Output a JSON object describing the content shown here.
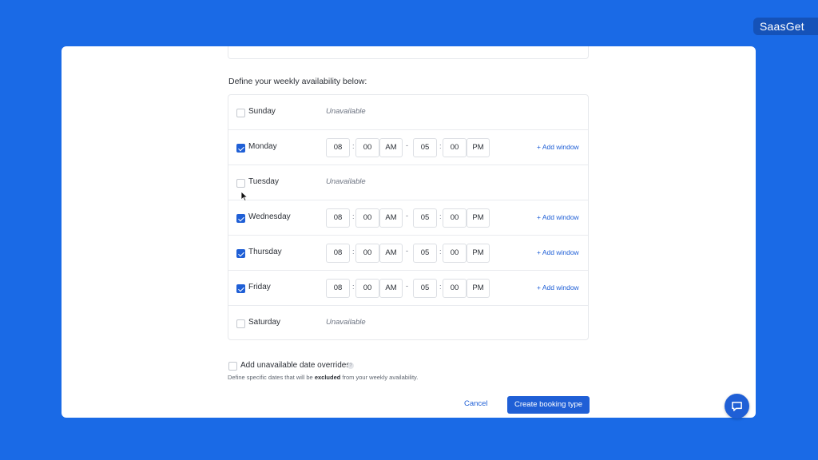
{
  "brand": {
    "name": "SaasGet"
  },
  "availability": {
    "title": "Define your weekly availability below:",
    "unavailable_text": "Unavailable",
    "add_window_label": "+ Add window",
    "days": [
      {
        "name": "Sunday",
        "checked": false,
        "unavailable": "Unavailable"
      },
      {
        "name": "Monday",
        "checked": true,
        "start_hour": "08",
        "start_min": "00",
        "start_ampm": "AM",
        "end_hour": "05",
        "end_min": "00",
        "end_ampm": "PM",
        "add_window": "+ Add window"
      },
      {
        "name": "Tuesday",
        "checked": false,
        "unavailable": "Unavailable"
      },
      {
        "name": "Wednesday",
        "checked": true,
        "start_hour": "08",
        "start_min": "00",
        "start_ampm": "AM",
        "end_hour": "05",
        "end_min": "00",
        "end_ampm": "PM",
        "add_window": "+ Add window"
      },
      {
        "name": "Thursday",
        "checked": true,
        "start_hour": "08",
        "start_min": "00",
        "start_ampm": "AM",
        "end_hour": "05",
        "end_min": "00",
        "end_ampm": "PM",
        "add_window": "+ Add window"
      },
      {
        "name": "Friday",
        "checked": true,
        "start_hour": "08",
        "start_min": "00",
        "start_ampm": "AM",
        "end_hour": "05",
        "end_min": "00",
        "end_ampm": "PM",
        "add_window": "+ Add window"
      },
      {
        "name": "Saturday",
        "checked": false,
        "unavailable": "Unavailable"
      }
    ]
  },
  "overrides": {
    "label": "Add unavailable date overrides",
    "checked": false,
    "desc_prefix": "Define specific dates that will be ",
    "desc_bold": "excluded",
    "desc_suffix": " from your weekly availability."
  },
  "footer": {
    "cancel_label": "Cancel",
    "submit_label": "Create booking type"
  },
  "colors": {
    "background": "#1a6ae6",
    "accent": "#1f5fd6"
  },
  "icons": {
    "chat": "chat-bubble-icon",
    "info": "info-icon",
    "cursor": "mouse-pointer-icon"
  }
}
